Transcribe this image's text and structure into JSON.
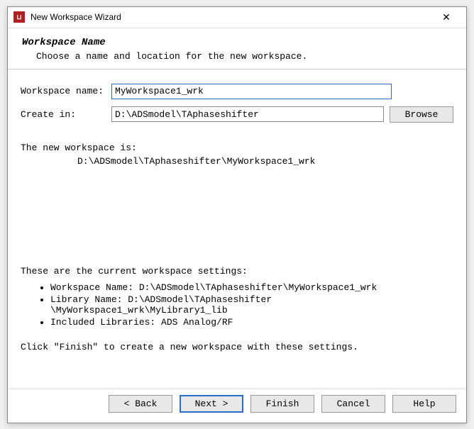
{
  "titlebar": {
    "title": "New Workspace Wizard",
    "close": "✕"
  },
  "header": {
    "title": "Workspace Name",
    "desc": "Choose a name and location for the new workspace."
  },
  "form": {
    "name_label": "Workspace name:",
    "name_value": "MyWorkspace1_wrk",
    "create_label": "Create in:",
    "create_value": "D:\\ADSmodel\\TAphaseshifter",
    "browse": "Browse"
  },
  "info": {
    "title": "The new workspace is:",
    "path": "D:\\ADSmodel\\TAphaseshifter\\MyWorkspace1_wrk"
  },
  "settings": {
    "title": "These are the current workspace settings:",
    "workspace_name": "Workspace Name:    D:\\ADSmodel\\TAphaseshifter\\MyWorkspace1_wrk",
    "library_name_1": "Library Name:            D:\\ADSmodel\\TAphaseshifter",
    "library_name_2": "\\MyWorkspace1_wrk\\MyLibrary1_lib",
    "included": "Included Libraries:    ADS Analog/RF",
    "note": "Click \"Finish\" to create a new workspace with these settings."
  },
  "buttons": {
    "back": "< Back",
    "next": "Next >",
    "finish": "Finish",
    "cancel": "Cancel",
    "help": "Help"
  }
}
